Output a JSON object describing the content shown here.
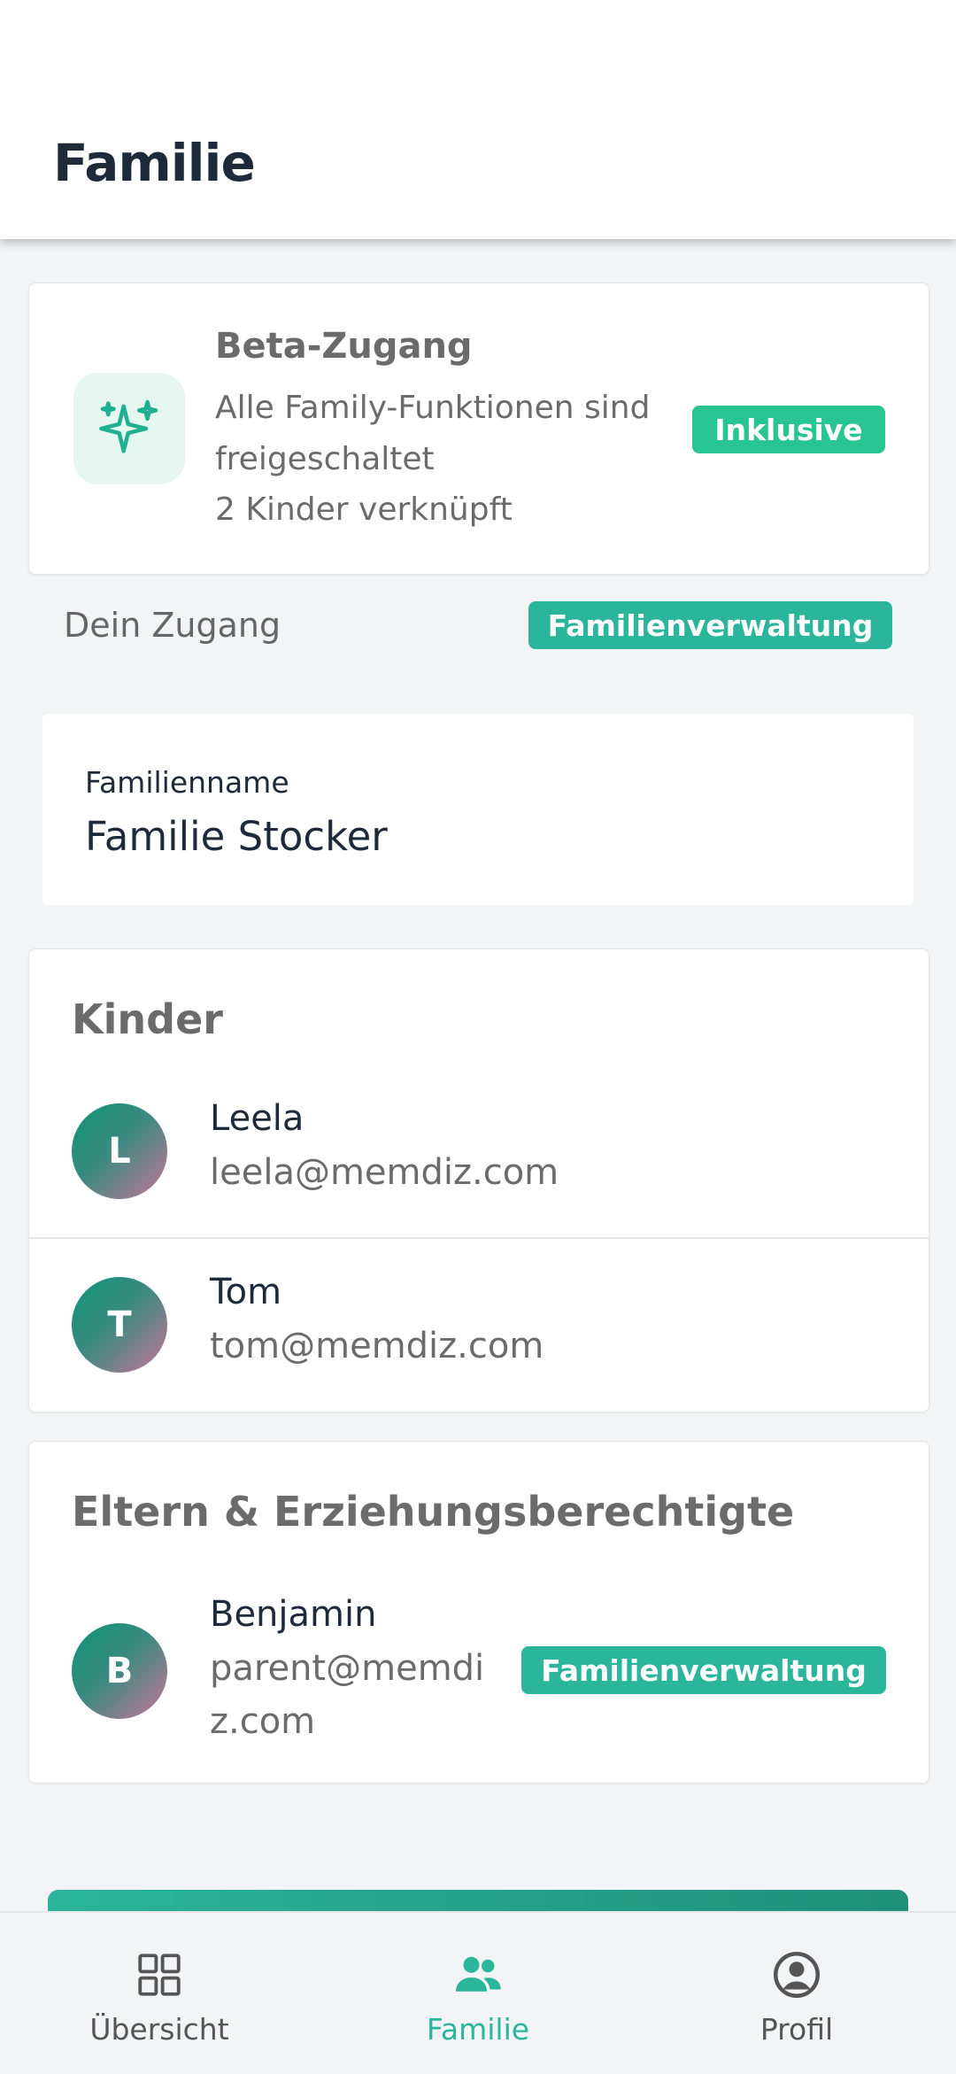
{
  "header": {
    "title": "Familie"
  },
  "beta": {
    "title": "Beta-Zugang",
    "description": "Alle Family-Funktionen sind freigeschaltet",
    "children_count": "2 Kinder verknüpft",
    "badge": "Inklusive",
    "icon": "sparkles-icon"
  },
  "access": {
    "label": "Dein Zugang",
    "badge": "Familienverwaltung"
  },
  "family": {
    "label": "Familienname",
    "value": "Familie Stocker"
  },
  "kids": {
    "title": "Kinder",
    "items": [
      {
        "initial": "L",
        "name": "Leela",
        "email": "leela@memdiz.com"
      },
      {
        "initial": "T",
        "name": "Tom",
        "email": "tom@memdiz.com"
      }
    ]
  },
  "parents": {
    "title": "Eltern & Erziehungsberechtigte",
    "items": [
      {
        "initial": "B",
        "name": "Benjamin",
        "email": "parent@memdiz.com",
        "badge": "Familienverwaltung"
      }
    ]
  },
  "nav": {
    "items": [
      {
        "label": "Übersicht",
        "icon": "grid-icon"
      },
      {
        "label": "Familie",
        "icon": "users-icon",
        "active": true
      },
      {
        "label": "Profil",
        "icon": "user-circle-icon"
      }
    ]
  },
  "colors": {
    "accent": "#2bb59a",
    "badge_green": "#28c592",
    "text_dark": "#1e2a3a",
    "text_muted": "#6b6b6b"
  }
}
